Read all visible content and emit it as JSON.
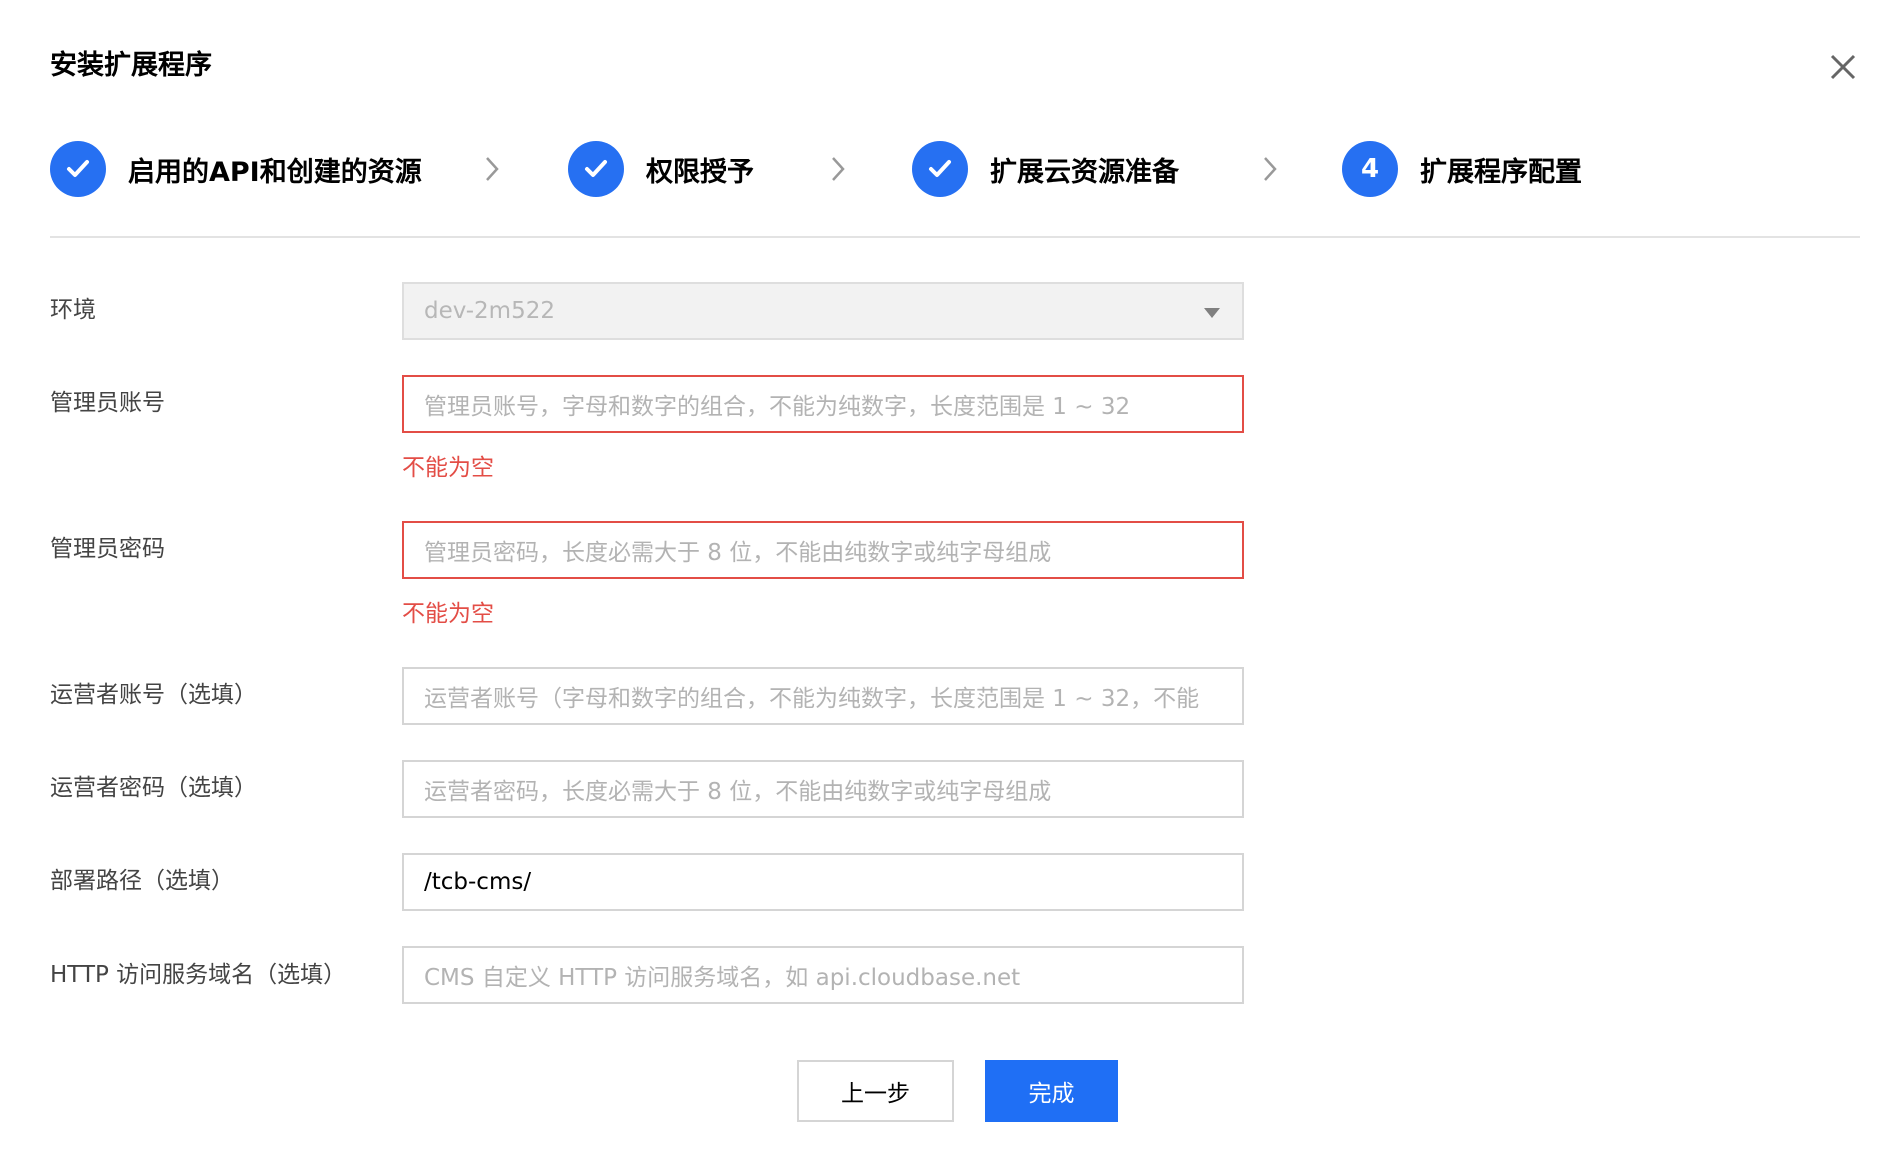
{
  "dialog": {
    "title": "安装扩展程序",
    "close_icon": "close-icon"
  },
  "steps": [
    {
      "label": "启用的API和创建的资源",
      "status": "done",
      "icon": "check-icon"
    },
    {
      "label": "权限授予",
      "status": "done",
      "icon": "check-icon"
    },
    {
      "label": "扩展云资源准备",
      "status": "done",
      "icon": "check-icon"
    },
    {
      "label": "扩展程序配置",
      "status": "current",
      "number": "4"
    }
  ],
  "form": {
    "env": {
      "label": "环境",
      "value": "dev-2m522"
    },
    "admin_account": {
      "label": "管理员账号",
      "placeholder": "管理员账号，字母和数字的组合，不能为纯数字，长度范围是 1 ~ 32",
      "error": "不能为空"
    },
    "admin_password": {
      "label": "管理员密码",
      "placeholder": "管理员密码，长度必需大于 8 位，不能由纯数字或纯字母组成",
      "error": "不能为空"
    },
    "operator_account": {
      "label": "运营者账号（选填）",
      "placeholder": "运营者账号（字母和数字的组合，不能为纯数字，长度范围是 1 ~ 32，不能"
    },
    "operator_password": {
      "label": "运营者密码（选填）",
      "placeholder": "运营者密码，长度必需大于 8 位，不能由纯数字或纯字母组成"
    },
    "deploy_path": {
      "label": "部署路径（选填）",
      "value": "/tcb-cms/"
    },
    "http_domain": {
      "label": "HTTP 访问服务域名（选填）",
      "placeholder": "CMS 自定义 HTTP 访问服务域名，如 api.cloudbase.net"
    }
  },
  "buttons": {
    "prev": "上一步",
    "done": "完成"
  },
  "colors": {
    "primary": "#1f6ff5",
    "error": "#e34d46",
    "border": "#d5d5d5"
  }
}
